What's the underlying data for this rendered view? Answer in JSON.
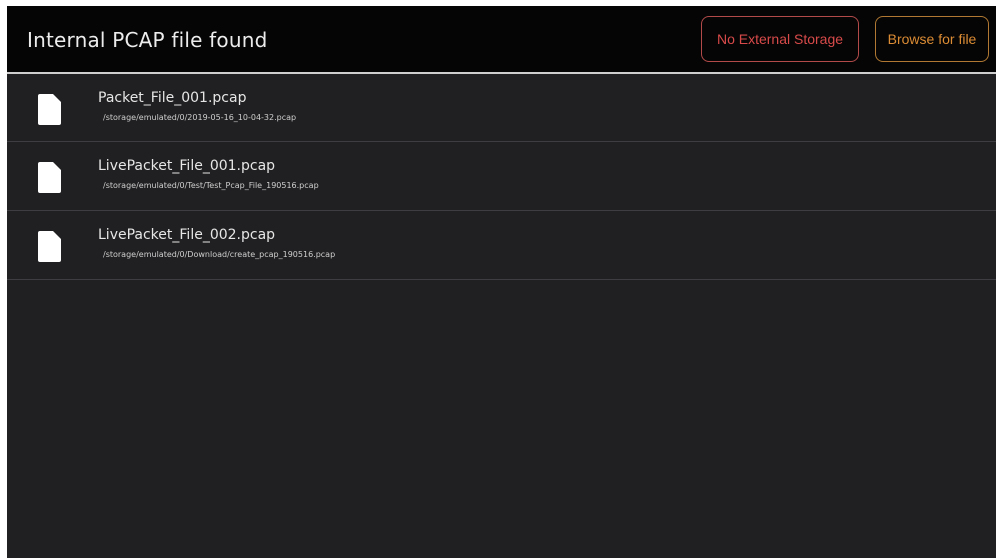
{
  "header": {
    "title": "Internal PCAP file found",
    "no_external_label": "No External Storage",
    "browse_label": "Browse for file"
  },
  "colors": {
    "header_bg": "#050505",
    "list_bg": "#202022",
    "no_external_accent": "#d84a4a",
    "browse_accent": "#dc8c34"
  },
  "files": [
    {
      "icon": "file-icon",
      "name": "Packet_File_001.pcap",
      "path": "/storage/emulated/0/2019-05-16_10-04-32.pcap"
    },
    {
      "icon": "file-icon",
      "name": "LivePacket_File_001.pcap",
      "path": "/storage/emulated/0/Test/Test_Pcap_File_190516.pcap"
    },
    {
      "icon": "file-icon",
      "name": "LivePacket_File_002.pcap",
      "path": "/storage/emulated/0/Download/create_pcap_190516.pcap"
    }
  ]
}
